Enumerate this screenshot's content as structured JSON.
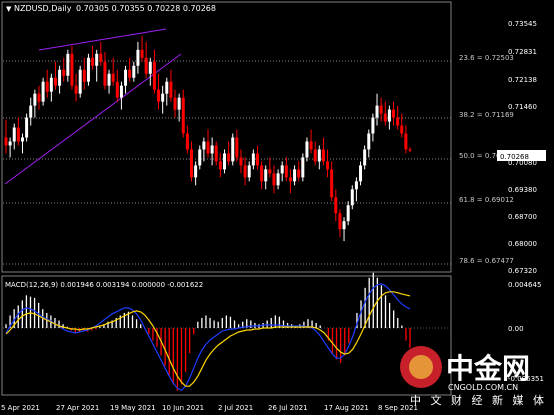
{
  "header": {
    "symbol_label": "NZDUSD,Daily",
    "ohlc_label": "0.70305 0.70355 0.70228 0.70268"
  },
  "price_axis": {
    "ticks": [
      "0.73545",
      "0.72831",
      "0.72138",
      "0.71460",
      "0.70080",
      "0.69380",
      "0.68700",
      "0.68000",
      "0.67320"
    ],
    "current_price": "0.70268"
  },
  "fib_levels": [
    {
      "label": "23.6 = 0.72503"
    },
    {
      "label": "38.2 = 0.71169"
    },
    {
      "label": "50.0 = 0.70091"
    },
    {
      "label": "61.8 = 0.69012"
    },
    {
      "label": "78.6 = 0.67477"
    }
  ],
  "macd": {
    "label": "MACD(12,26,9) 0.001946 0.003194 0.000000 -0.001622",
    "ticks": [
      "0.004645",
      "0.00",
      "-0.006351"
    ]
  },
  "time_axis": {
    "ticks": [
      "5 Apr 2021",
      "27 Apr 2021",
      "19 May 2021",
      "10 Jun 2021",
      "2 Jul 2021",
      "26 Jul 2021",
      "17 Aug 2021",
      "8 Sep 2021"
    ]
  },
  "watermark": {
    "brand": "中金网",
    "url": "CNGOLD.COM.CN",
    "slogan": "中 文 财 经 新 媒 体"
  },
  "colors": {
    "background": "#000000",
    "bull": "#ffffff",
    "bear": "#ff0000",
    "trendline": "#a020f0",
    "macd_line": "#1e3cff",
    "signal_line": "#ffd700",
    "grid": "#7a7a7a",
    "watermark_circle": "#c8202a"
  },
  "chart_data": {
    "type": "candlestick",
    "symbol": "NZDUSD",
    "timeframe": "Daily",
    "ylim": [
      0.6725,
      0.7395
    ],
    "candles": [
      [
        0.706,
        0.7105,
        0.702,
        0.704
      ],
      [
        0.704,
        0.706,
        0.701,
        0.705
      ],
      [
        0.705,
        0.7095,
        0.703,
        0.7085
      ],
      [
        0.7085,
        0.711,
        0.704,
        0.705
      ],
      [
        0.705,
        0.707,
        0.702,
        0.706
      ],
      [
        0.706,
        0.712,
        0.705,
        0.711
      ],
      [
        0.711,
        0.716,
        0.709,
        0.714
      ],
      [
        0.714,
        0.718,
        0.711,
        0.717
      ],
      [
        0.717,
        0.719,
        0.713,
        0.715
      ],
      [
        0.715,
        0.721,
        0.714,
        0.72
      ],
      [
        0.72,
        0.723,
        0.716,
        0.7175
      ],
      [
        0.7175,
        0.722,
        0.715,
        0.721
      ],
      [
        0.721,
        0.725,
        0.718,
        0.719
      ],
      [
        0.719,
        0.724,
        0.717,
        0.723
      ],
      [
        0.723,
        0.726,
        0.72,
        0.7215
      ],
      [
        0.7215,
        0.728,
        0.72,
        0.727
      ],
      [
        0.727,
        0.729,
        0.718,
        0.719
      ],
      [
        0.719,
        0.722,
        0.715,
        0.717
      ],
      [
        0.717,
        0.724,
        0.716,
        0.723
      ],
      [
        0.723,
        0.726,
        0.718,
        0.72
      ],
      [
        0.72,
        0.727,
        0.719,
        0.726
      ],
      [
        0.726,
        0.729,
        0.723,
        0.724
      ],
      [
        0.724,
        0.728,
        0.72,
        0.727
      ],
      [
        0.727,
        0.73,
        0.724,
        0.725
      ],
      [
        0.725,
        0.7275,
        0.718,
        0.719
      ],
      [
        0.719,
        0.723,
        0.717,
        0.722
      ],
      [
        0.722,
        0.726,
        0.719,
        0.72
      ],
      [
        0.72,
        0.723,
        0.715,
        0.716
      ],
      [
        0.716,
        0.72,
        0.713,
        0.719
      ],
      [
        0.719,
        0.724,
        0.717,
        0.723
      ],
      [
        0.723,
        0.726,
        0.72,
        0.721
      ],
      [
        0.721,
        0.725,
        0.72,
        0.724
      ],
      [
        0.724,
        0.73,
        0.722,
        0.728
      ],
      [
        0.728,
        0.7315,
        0.725,
        0.726
      ],
      [
        0.726,
        0.73,
        0.721,
        0.722
      ],
      [
        0.722,
        0.726,
        0.719,
        0.725
      ],
      [
        0.725,
        0.728,
        0.717,
        0.718
      ],
      [
        0.718,
        0.722,
        0.713,
        0.715
      ],
      [
        0.715,
        0.719,
        0.712,
        0.717
      ],
      [
        0.717,
        0.721,
        0.714,
        0.72
      ],
      [
        0.72,
        0.723,
        0.715,
        0.716
      ],
      [
        0.716,
        0.718,
        0.711,
        0.713
      ],
      [
        0.713,
        0.717,
        0.71,
        0.716
      ],
      [
        0.716,
        0.718,
        0.706,
        0.707
      ],
      [
        0.707,
        0.709,
        0.702,
        0.703
      ],
      [
        0.703,
        0.705,
        0.695,
        0.696
      ],
      [
        0.696,
        0.7,
        0.694,
        0.699
      ],
      [
        0.699,
        0.704,
        0.698,
        0.703
      ],
      [
        0.703,
        0.706,
        0.7,
        0.705
      ],
      [
        0.705,
        0.708,
        0.701,
        0.702
      ],
      [
        0.702,
        0.706,
        0.699,
        0.704
      ],
      [
        0.704,
        0.705,
        0.699,
        0.7
      ],
      [
        0.7,
        0.702,
        0.696,
        0.698
      ],
      [
        0.698,
        0.703,
        0.697,
        0.702
      ],
      [
        0.702,
        0.705,
        0.699,
        0.7
      ],
      [
        0.7,
        0.707,
        0.699,
        0.706
      ],
      [
        0.706,
        0.708,
        0.7,
        0.701
      ],
      [
        0.701,
        0.703,
        0.697,
        0.699
      ],
      [
        0.699,
        0.701,
        0.694,
        0.696
      ],
      [
        0.696,
        0.7,
        0.695,
        0.699
      ],
      [
        0.699,
        0.703,
        0.698,
        0.702
      ],
      [
        0.702,
        0.704,
        0.698,
        0.699
      ],
      [
        0.699,
        0.7,
        0.693,
        0.695
      ],
      [
        0.695,
        0.699,
        0.693,
        0.698
      ],
      [
        0.698,
        0.701,
        0.696,
        0.697
      ],
      [
        0.697,
        0.699,
        0.692,
        0.694
      ],
      [
        0.694,
        0.698,
        0.693,
        0.697
      ],
      [
        0.697,
        0.7,
        0.695,
        0.699
      ],
      [
        0.699,
        0.701,
        0.695,
        0.696
      ],
      [
        0.696,
        0.698,
        0.692,
        0.695
      ],
      [
        0.695,
        0.699,
        0.694,
        0.698
      ],
      [
        0.698,
        0.7,
        0.695,
        0.696
      ],
      [
        0.696,
        0.702,
        0.695,
        0.701
      ],
      [
        0.701,
        0.706,
        0.7,
        0.705
      ],
      [
        0.705,
        0.708,
        0.702,
        0.703
      ],
      [
        0.703,
        0.705,
        0.699,
        0.7
      ],
      [
        0.7,
        0.704,
        0.698,
        0.703
      ],
      [
        0.703,
        0.706,
        0.699,
        0.7
      ],
      [
        0.7,
        0.703,
        0.696,
        0.698
      ],
      [
        0.698,
        0.7,
        0.69,
        0.691
      ],
      [
        0.691,
        0.693,
        0.685,
        0.687
      ],
      [
        0.687,
        0.688,
        0.681,
        0.683
      ],
      [
        0.683,
        0.686,
        0.68,
        0.685
      ],
      [
        0.685,
        0.69,
        0.684,
        0.689
      ],
      [
        0.689,
        0.694,
        0.688,
        0.693
      ],
      [
        0.693,
        0.696,
        0.69,
        0.695
      ],
      [
        0.695,
        0.7,
        0.694,
        0.699
      ],
      [
        0.699,
        0.704,
        0.698,
        0.703
      ],
      [
        0.703,
        0.708,
        0.701,
        0.707
      ],
      [
        0.707,
        0.712,
        0.705,
        0.711
      ],
      [
        0.711,
        0.717,
        0.709,
        0.714
      ],
      [
        0.714,
        0.716,
        0.71,
        0.712
      ],
      [
        0.712,
        0.715,
        0.709,
        0.71
      ],
      [
        0.71,
        0.714,
        0.708,
        0.713
      ],
      [
        0.713,
        0.715,
        0.709,
        0.711
      ],
      [
        0.711,
        0.714,
        0.708,
        0.709
      ],
      [
        0.709,
        0.712,
        0.706,
        0.707
      ],
      [
        0.707,
        0.709,
        0.702,
        0.703
      ],
      [
        0.703,
        0.7036,
        0.7023,
        0.7027
      ]
    ],
    "macd": {
      "histogram": [
        0.0003,
        0.001,
        0.0015,
        0.0018,
        0.0022,
        0.0026,
        0.0025,
        0.0024,
        0.002,
        0.0015,
        0.0012,
        0.001,
        0.0008,
        0.0006,
        0.0003,
        0.0001,
        -0.0002,
        -0.0004,
        -0.0003,
        -0.0002,
        -0.0003,
        -0.0002,
        -0.0001,
        0.0001,
        0.0003,
        0.0005,
        0.0006,
        0.0008,
        0.001,
        0.0012,
        0.0013,
        0.001,
        0.0007,
        0.0003,
        0.0,
        -0.0005,
        -0.001,
        -0.0015,
        -0.0022,
        -0.003,
        -0.0038,
        -0.0045,
        -0.005,
        -0.0045,
        -0.0035,
        -0.002,
        -0.0005,
        0.0005,
        0.0008,
        0.001,
        0.0008,
        0.0006,
        0.0005,
        0.0008,
        0.001,
        0.0009,
        0.0006,
        0.0003,
        0.0005,
        0.0007,
        0.0006,
        0.0004,
        0.0003,
        0.0004,
        0.0006,
        0.0008,
        0.001,
        0.0009,
        0.0006,
        0.0004,
        0.0003,
        0.0002,
        0.0003,
        0.0005,
        0.0007,
        0.0006,
        0.0004,
        0.0002,
        0.0,
        -0.001,
        -0.002,
        -0.0025,
        -0.0028,
        -0.0022,
        -0.0012,
        0.0,
        0.0012,
        0.0022,
        0.0032,
        0.004,
        0.0044,
        0.004,
        0.0034,
        0.0026,
        0.002,
        0.0014,
        0.0008,
        0.0002,
        -0.001,
        -0.0016
      ],
      "signal": [
        -0.0006,
        -0.0002,
        0.0003,
        0.0008,
        0.0012,
        0.0014,
        0.0015,
        0.0014,
        0.0012,
        0.001,
        0.0008,
        0.0006,
        0.0004,
        0.0002,
        0.0001,
        0.0,
        -0.0001,
        -0.0001,
        -0.0002,
        -0.0001,
        -0.0001,
        0.0,
        0.0001,
        0.0002,
        0.0003,
        0.0005,
        0.0006,
        0.0008,
        0.001,
        0.0012,
        0.0014,
        0.0016,
        0.0017,
        0.0016,
        0.0013,
        0.0008,
        0.0002,
        -0.0005,
        -0.0013,
        -0.0022,
        -0.0031,
        -0.004,
        -0.0048,
        -0.0054,
        -0.0058,
        -0.0058,
        -0.0054,
        -0.0048,
        -0.004,
        -0.0032,
        -0.0026,
        -0.0021,
        -0.0017,
        -0.0014,
        -0.0011,
        -0.0008,
        -0.0006,
        -0.0004,
        -0.0003,
        -0.0002,
        -0.0002,
        -0.0001,
        -0.0001,
        0.0,
        0.0,
        0.0,
        0.0001,
        0.0001,
        0.0001,
        0.0001,
        0.0001,
        0.0001,
        0.0001,
        0.0001,
        0.0001,
        0.0001,
        0.0,
        -0.0002,
        -0.0005,
        -0.001,
        -0.0015,
        -0.002,
        -0.0024,
        -0.0026,
        -0.0025,
        -0.0021,
        -0.0014,
        -0.0006,
        0.0003,
        0.0012,
        0.002,
        0.0027,
        0.0032,
        0.0035,
        0.0036,
        0.0036,
        0.0035,
        0.0034,
        0.0033,
        0.0032
      ],
      "macd_line": [
        -0.0005,
        0.0002,
        0.0008,
        0.0014,
        0.0018,
        0.002,
        0.0019,
        0.0017,
        0.0014,
        0.0011,
        0.0009,
        0.0007,
        0.0004,
        0.0002,
        -0.0001,
        -0.0003,
        -0.0004,
        -0.0005,
        -0.0004,
        -0.0003,
        -0.0002,
        0.0,
        0.0002,
        0.0005,
        0.0008,
        0.0011,
        0.0014,
        0.0016,
        0.0018,
        0.002,
        0.002,
        0.0018,
        0.0014,
        0.0008,
        0.0,
        -0.0008,
        -0.0016,
        -0.0024,
        -0.0032,
        -0.004,
        -0.0048,
        -0.0055,
        -0.006,
        -0.0062,
        -0.0058,
        -0.005,
        -0.004,
        -0.003,
        -0.0022,
        -0.0016,
        -0.0012,
        -0.0009,
        -0.0006,
        -0.0003,
        -0.0002,
        -0.0001,
        -0.0001,
        0.0,
        0.0001,
        0.0001,
        0.0002,
        0.0002,
        0.0002,
        0.0003,
        0.0003,
        0.0003,
        0.0003,
        0.0003,
        0.0002,
        0.0002,
        0.0002,
        0.0002,
        0.0002,
        0.0002,
        0.0001,
        0.0,
        -0.0003,
        -0.0008,
        -0.0014,
        -0.002,
        -0.0026,
        -0.003,
        -0.003,
        -0.0026,
        -0.0018,
        -0.0008,
        0.0004,
        0.0016,
        0.0026,
        0.0034,
        0.004,
        0.0043,
        0.0044,
        0.0042,
        0.0038,
        0.0033,
        0.0028,
        0.0024,
        0.0021,
        0.0019
      ]
    }
  }
}
